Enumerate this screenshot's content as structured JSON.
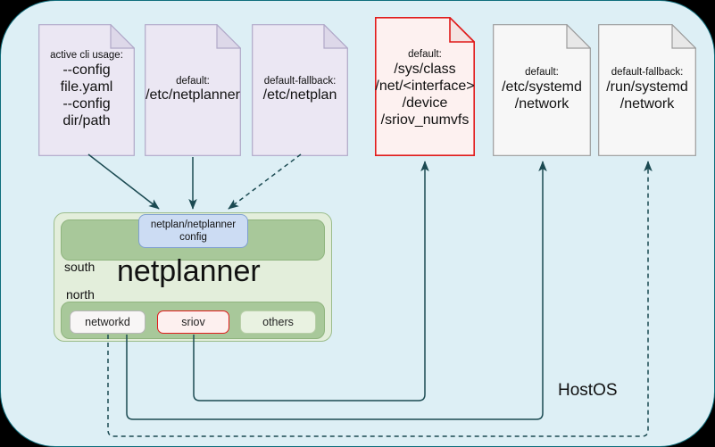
{
  "diagram": {
    "title_node": "netplanner",
    "host_label": "HostOS",
    "south_label": "south",
    "north_label": "north",
    "config_node": "netplan/netplanner config",
    "config_line1": "netplan/netplanner",
    "config_line2": "config",
    "colors": {
      "canvas": "#ddeff5",
      "frame_border": "#0f6e7d",
      "doc_purple_fill": "#ebe7f3",
      "doc_purple_border": "#b0a8c8",
      "doc_red_fill": "#fdf1f0",
      "doc_red_border": "#e01b1b",
      "doc_grey_fill": "#f7f7f7",
      "doc_grey_border": "#9b9b9b",
      "panel_outer": "#e3eedb",
      "band": "#a8c89a",
      "config_fill": "#ccdcf3",
      "wire": "#1b4a52"
    },
    "documents": [
      {
        "id": "active-cli",
        "style": "purple",
        "lines": [
          {
            "text": "active cli usage:",
            "size": "small"
          },
          {
            "text": "--config file.yaml",
            "size": "large"
          },
          {
            "text": "--config dir/path",
            "size": "large"
          }
        ]
      },
      {
        "id": "netplanner-default",
        "style": "purple",
        "lines": [
          {
            "text": "default:",
            "size": "small"
          },
          {
            "text": "/etc/netplanner",
            "size": "large"
          }
        ]
      },
      {
        "id": "netplan-fallback",
        "style": "purple",
        "lines": [
          {
            "text": "default-fallback:",
            "size": "small"
          },
          {
            "text": "/etc/netplan",
            "size": "large"
          }
        ]
      },
      {
        "id": "sriov-numvfs",
        "style": "red",
        "lines": [
          {
            "text": "default:",
            "size": "small"
          },
          {
            "text": "/sys/class",
            "size": "large"
          },
          {
            "text": "/net/<interface>",
            "size": "large"
          },
          {
            "text": "/device",
            "size": "large"
          },
          {
            "text": "/sriov_numvfs",
            "size": "large"
          }
        ]
      },
      {
        "id": "etc-systemd-network",
        "style": "grey",
        "lines": [
          {
            "text": "default:",
            "size": "small"
          },
          {
            "text": "/etc/systemd",
            "size": "large"
          },
          {
            "text": "/network",
            "size": "large"
          }
        ]
      },
      {
        "id": "run-systemd-network",
        "style": "grey",
        "lines": [
          {
            "text": "default-fallback:",
            "size": "small"
          },
          {
            "text": "/run/systemd",
            "size": "large"
          },
          {
            "text": "/network",
            "size": "large"
          }
        ]
      }
    ],
    "plugins": [
      {
        "id": "networkd",
        "label": "networkd",
        "style": "grey"
      },
      {
        "id": "sriov",
        "label": "sriov",
        "style": "red"
      },
      {
        "id": "others",
        "label": "others",
        "style": "green"
      }
    ],
    "edges": [
      {
        "from": "active-cli",
        "to": "config_node",
        "style": "solid",
        "arrow": true
      },
      {
        "from": "netplanner-default",
        "to": "config_node",
        "style": "solid",
        "arrow": true
      },
      {
        "from": "netplan-fallback",
        "to": "config_node",
        "style": "dashed",
        "arrow": true
      },
      {
        "from": "sriov",
        "to": "sriov-numvfs",
        "style": "solid",
        "arrow": true
      },
      {
        "from": "networkd",
        "to": "etc-systemd-network",
        "style": "solid",
        "arrow": true
      },
      {
        "from": "networkd",
        "to": "run-systemd-network",
        "style": "dashed",
        "arrow": true
      }
    ]
  }
}
